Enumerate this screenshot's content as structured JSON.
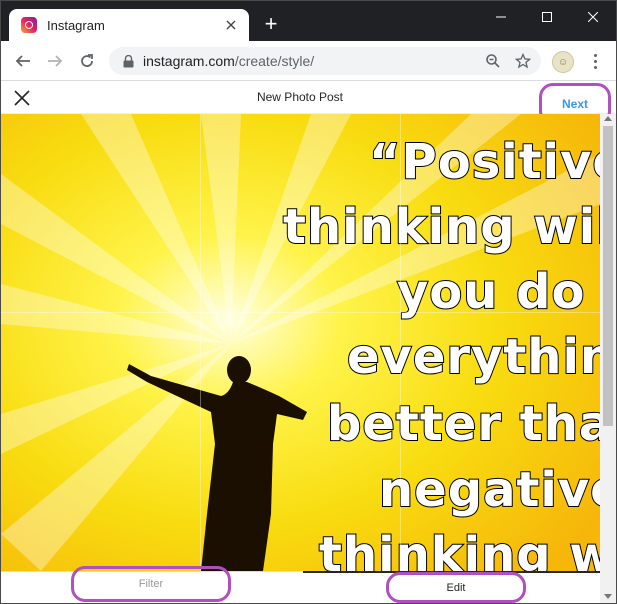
{
  "browser": {
    "tab_title": "Instagram",
    "new_tab_label": "+",
    "url_host": "instagram.com",
    "url_path": "/create/style/"
  },
  "instagram": {
    "header_title": "New Photo Post",
    "next_label": "Next",
    "bottom_tabs": {
      "filter_label": "Filter",
      "edit_label": "Edit",
      "active": "Edit"
    }
  },
  "image_quote": {
    "lines": [
      "“Positive",
      "thinking will",
      "you do",
      "everything",
      "better tha",
      "negative",
      "thinking wil"
    ]
  },
  "colors": {
    "accent_next": "#3897f0",
    "annotation_outline": "#b04fc0",
    "image_yellow": "#f6d40f"
  }
}
